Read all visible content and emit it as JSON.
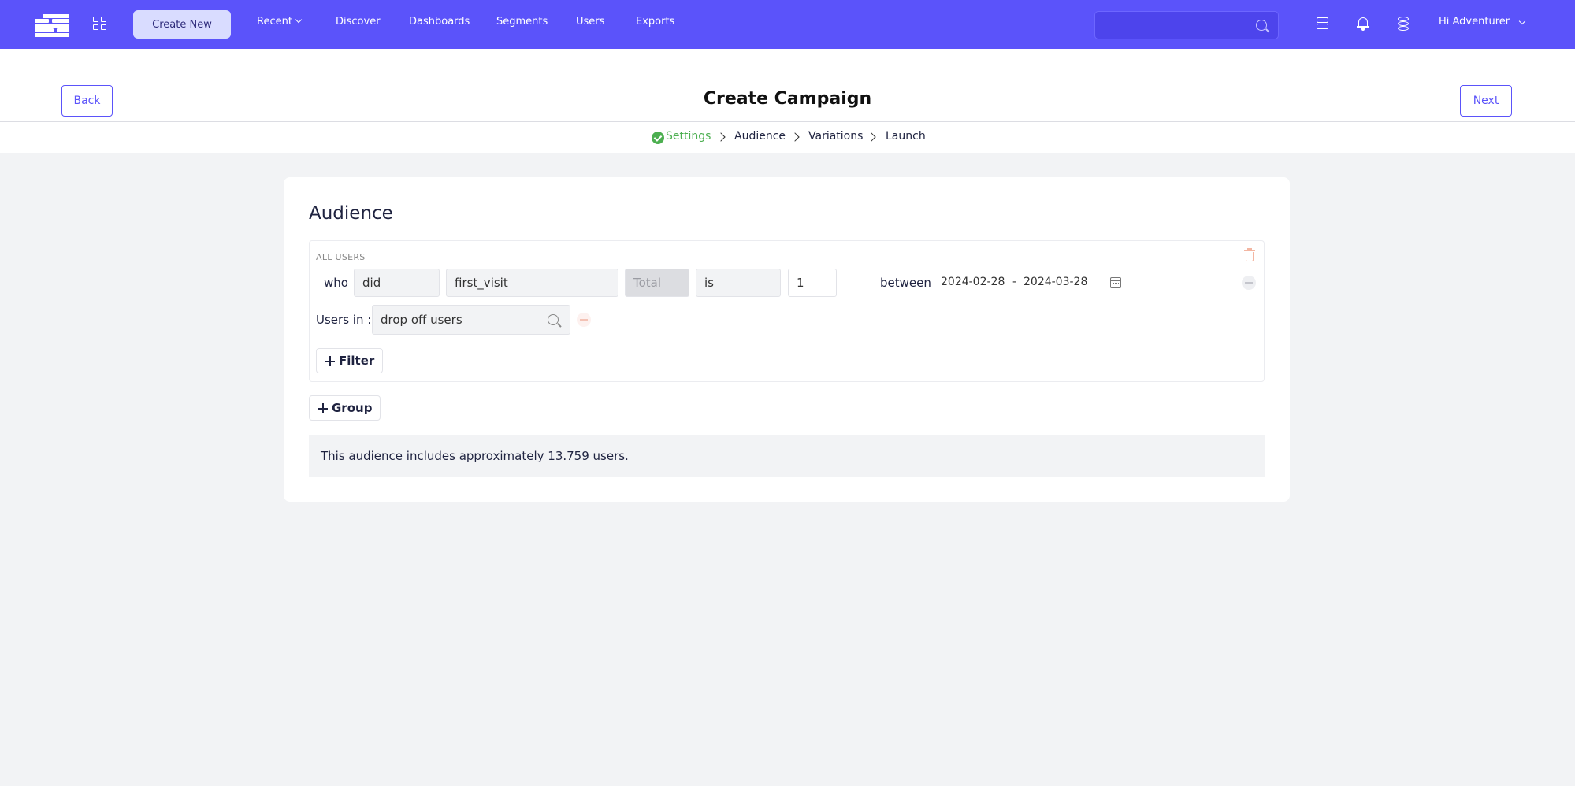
{
  "nav": {
    "logo_icon": "stacked-bars-logo",
    "apps_icon": "grid-icon",
    "create_new": "Create New",
    "recent": "Recent",
    "discover": "Discover",
    "dashboards": "Dashboards",
    "segments": "Segments",
    "users": "Users",
    "exports": "Exports",
    "search_placeholder": "",
    "greeting": "Hi Adventurer",
    "accent_color": "#5b53fa"
  },
  "header": {
    "title": "Create Campaign",
    "back_label": "Back",
    "next_label": "Next",
    "steps": [
      {
        "label": "Settings",
        "status": "done"
      },
      {
        "label": "Audience",
        "status": "current"
      },
      {
        "label": "Variations",
        "status": "pending"
      },
      {
        "label": "Launch",
        "status": "pending"
      }
    ]
  },
  "audience": {
    "title": "Audience",
    "group_label": "ALL USERS",
    "condition": {
      "who_label": "who",
      "did_value": "did",
      "event_value": "first_visit",
      "aggregation_placeholder": "Total",
      "operator_value": "is",
      "count_value": "1",
      "between_label": "between",
      "date_from": "2024-02-28",
      "date_separator": "-",
      "date_to": "2024-03-28"
    },
    "users_in_label": "Users in :",
    "segment_value": "drop off users",
    "filter_button": "Filter",
    "group_button": "Group",
    "estimate_text": "This audience includes approximately 13.759 users."
  }
}
